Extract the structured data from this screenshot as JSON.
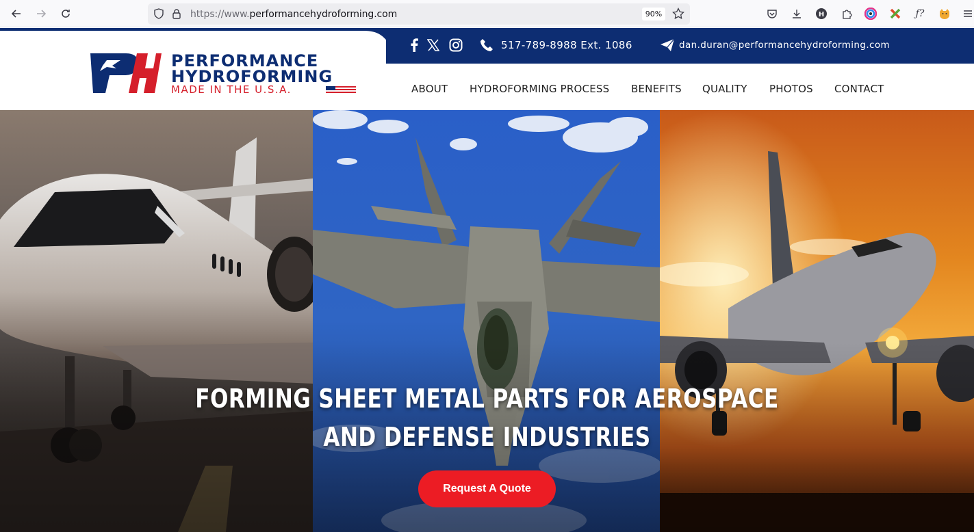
{
  "browser": {
    "url_prefix": "https://www.",
    "url_host": "performancehydroforming.com",
    "zoom": "90%",
    "icons": [
      "back-icon",
      "forward-icon",
      "reload-icon",
      "shield-icon",
      "lock-icon",
      "star-icon",
      "pocket-icon",
      "download-icon",
      "profile-h-icon",
      "extensions-icon",
      "color-icon",
      "x-ext-icon",
      "f-ext-icon",
      "cat-icon",
      "menu-icon"
    ]
  },
  "header": {
    "logo": {
      "line1": "PERFORMANCE",
      "line2": "HYDROFORMING",
      "line3": "MADE IN THE U.S.A."
    },
    "social": [
      "facebook-icon",
      "x-icon",
      "instagram-icon"
    ],
    "phone": "517-789-8988 Ext. 1086",
    "email": "dan.duran@performancehydroforming.com",
    "nav": [
      "ABOUT",
      "HYDROFORMING PROCESS",
      "BENEFITS",
      "QUALITY",
      "PHOTOS",
      "CONTACT"
    ],
    "colors": {
      "brand_blue": "#0d2d72",
      "brand_red": "#d51f2b"
    }
  },
  "hero": {
    "title_line1": "FORMING SHEET METAL PARTS FOR AEROSPACE",
    "title_line2": "AND DEFENSE INDUSTRIES",
    "cta": "Request A Quote",
    "cta_color": "#ec1c24"
  }
}
